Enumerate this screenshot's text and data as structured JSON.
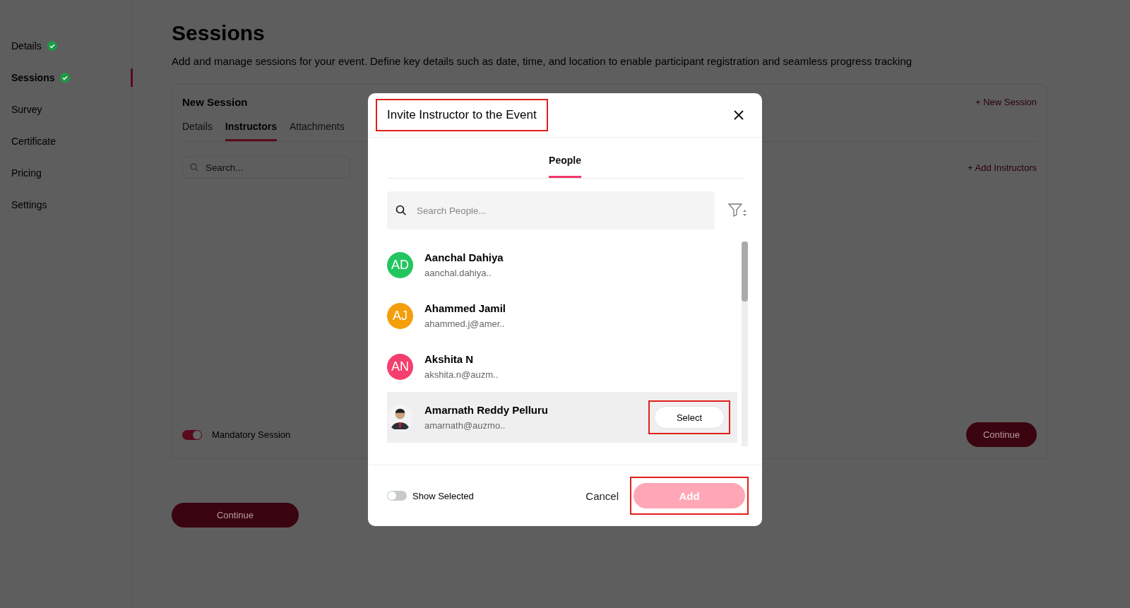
{
  "sidebar": {
    "items": [
      {
        "label": "Details",
        "done": true,
        "selected": false
      },
      {
        "label": "Sessions",
        "done": true,
        "selected": true
      },
      {
        "label": "Survey",
        "done": false,
        "selected": false
      },
      {
        "label": "Certificate",
        "done": false,
        "selected": false
      },
      {
        "label": "Pricing",
        "done": false,
        "selected": false
      },
      {
        "label": "Settings",
        "done": false,
        "selected": false
      }
    ]
  },
  "page": {
    "title": "Sessions",
    "description": "Add and manage sessions for your event. Define key details such as date, time, and location to enable participant registration and seamless progress tracking",
    "card": {
      "title": "New Session",
      "new_session_link": "+ New Session",
      "tabs": [
        {
          "label": "Details",
          "selected": false
        },
        {
          "label": "Instructors",
          "selected": true
        },
        {
          "label": "Attachments",
          "selected": false
        }
      ],
      "search": {
        "placeholder": "Search..."
      },
      "add_link": "+ Add Instructors",
      "mandatory": {
        "label": "Mandatory Session",
        "on": true
      },
      "continue": "Continue"
    },
    "continue": "Continue"
  },
  "modal": {
    "title": "Invite Instructor to the Event",
    "title_highlighted": true,
    "tabs": [
      {
        "label": "People",
        "selected": true
      }
    ],
    "search": {
      "placeholder": "Search People..."
    },
    "people": [
      {
        "name": "Aanchal Dahiya",
        "email": "aanchal.dahiya..",
        "kind": "initials",
        "initials": "AD",
        "color": "#22c55e",
        "hovered": false
      },
      {
        "name": "Ahammed Jamil",
        "email": "ahammed.j@amer..",
        "kind": "initials",
        "initials": "AJ",
        "color": "#f59e0b",
        "hovered": false
      },
      {
        "name": "Akshita N",
        "email": "akshita.n@auzm..",
        "kind": "initials",
        "initials": "AN",
        "color": "#f43f6e",
        "hovered": false
      },
      {
        "name": "Amarnath Reddy Pelluru",
        "email": "amarnath@auzmo..",
        "kind": "photo",
        "hovered": true,
        "action": "Select",
        "action_highlighted": true
      }
    ],
    "show_selected": {
      "label": "Show Selected",
      "on": false
    },
    "cancel": "Cancel",
    "add": {
      "label": "Add",
      "disabled": true,
      "highlighted": true
    }
  }
}
